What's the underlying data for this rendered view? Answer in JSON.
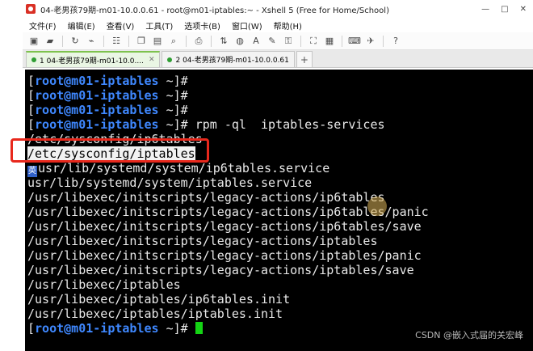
{
  "window": {
    "title": "04-老男孩79期-m01-10.0.0.61 - root@m01-iptables:~ - Xshell 5 (Free for Home/School)",
    "controls": [
      "—",
      "□",
      "✕"
    ]
  },
  "menu": {
    "items": [
      "文件(F)",
      "编辑(E)",
      "查看(V)",
      "工具(T)",
      "选项卡(B)",
      "窗口(W)",
      "帮助(H)"
    ]
  },
  "toolbar": {
    "icons": [
      "new-session-icon",
      "open-folder-icon",
      "reconnect-icon",
      "disconnect-icon",
      "properties-icon",
      "copy-icon",
      "paste-icon",
      "find-icon",
      "print-icon",
      "transfer-icon",
      "globe-icon",
      "font-icon",
      "color-icon",
      "lock-icon",
      "fullscreen-icon",
      "layout-icon",
      "keyboard-icon",
      "send-icon",
      "help-icon"
    ]
  },
  "tabs": [
    {
      "label": "1 04-老男孩79期-m01-10.0....",
      "active": true,
      "status": "connected"
    },
    {
      "label": "2 04-老男孩79期-m01-10.0.0.61",
      "active": false,
      "status": "connected"
    }
  ],
  "tab_add_label": "+",
  "terminal": {
    "prompt": {
      "user_host": "root@m01-iptables",
      "dir": "~",
      "symbol": "#"
    },
    "command": "rpm -ql  iptables-services",
    "output_lines": [
      "/etc/sysconfig/ip6tables",
      "/etc/sysconfig/iptables",
      "usr/lib/systemd/system/ip6tables.service",
      "usr/lib/systemd/system/iptables.service",
      "/usr/libexec/initscripts/legacy-actions/ip6tables",
      "/usr/libexec/initscripts/legacy-actions/ip6tables/panic",
      "/usr/libexec/initscripts/legacy-actions/ip6tables/save",
      "/usr/libexec/initscripts/legacy-actions/iptables",
      "/usr/libexec/initscripts/legacy-actions/iptables/panic",
      "/usr/libexec/initscripts/legacy-actions/iptables/save",
      "/usr/libexec/iptables",
      "/usr/libexec/iptables/ip6tables.init",
      "/usr/libexec/iptables/iptables.init"
    ],
    "ime_indicator": "英",
    "colors": {
      "background": "#000000",
      "prompt_user": "#3f88ff",
      "text": "#e9e9e9",
      "cursor": "#14d414",
      "highlight_box": "#e8281c"
    }
  },
  "watermark": "CSDN @嵌入式届的关宏峰"
}
